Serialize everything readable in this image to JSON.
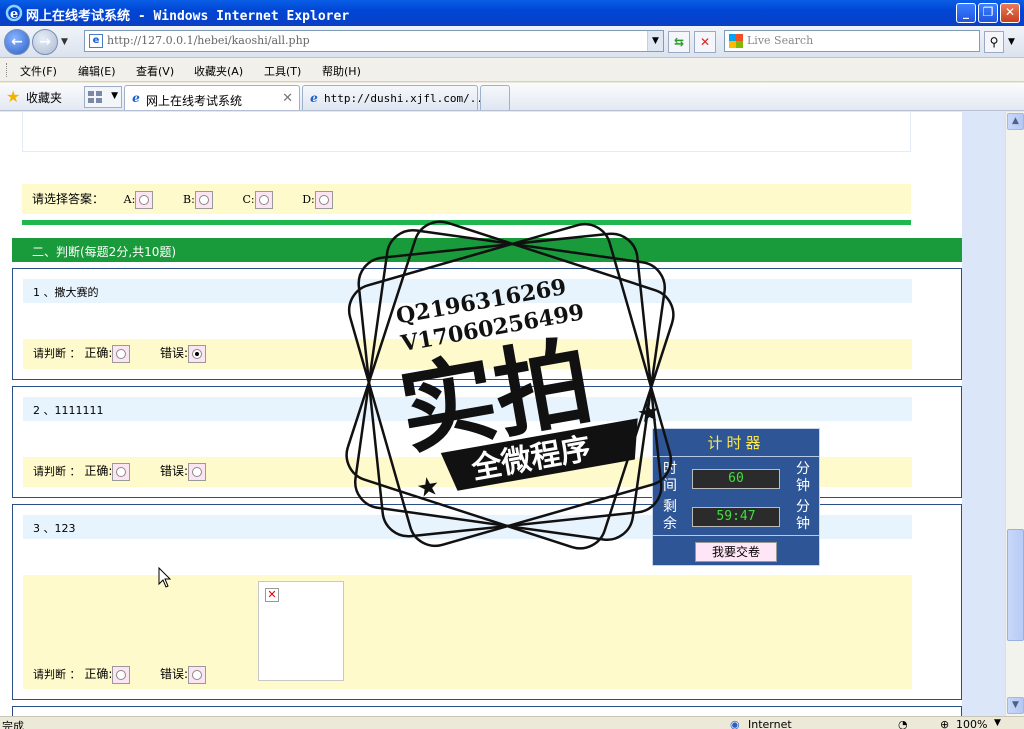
{
  "window": {
    "title": "网上在线考试系统 - Windows Internet Explorer",
    "minimize": "_",
    "restore": "❐",
    "close": "✕"
  },
  "address": {
    "url": "http://127.0.0.1/hebei/kaoshi/all.php",
    "search_placeholder": "Live Search"
  },
  "menu": [
    "文件(F)",
    "编辑(E)",
    "查看(V)",
    "收藏夹(A)",
    "工具(T)",
    "帮助(H)"
  ],
  "favorites": {
    "label": "收藏夹",
    "tabs": [
      {
        "label": "网上在线考试系统"
      },
      {
        "label": "http://dushi.xjfl.com/..."
      }
    ]
  },
  "exam": {
    "choice_prompt": "请选择答案：",
    "choice_options": [
      "A:",
      "B:",
      "C:",
      "D:"
    ],
    "section_title": "二、判断(每题2分,共10题)",
    "judge_prefix": "请判断 ：",
    "correct_label": "正确:",
    "wrong_label": "错误:",
    "questions": [
      {
        "text": "1 、撒大赛的",
        "selected": "wrong"
      },
      {
        "text": "2 、1111111",
        "selected": "none"
      },
      {
        "text": "3 、123",
        "selected": "none"
      }
    ]
  },
  "timer": {
    "title": "计时器",
    "total_label": [
      "时",
      "间"
    ],
    "remain_label": [
      "剩",
      "余"
    ],
    "unit": [
      "分",
      "钟"
    ],
    "total_value": "60",
    "remain_value": "59:47",
    "submit_label": "我要交卷"
  },
  "watermark": {
    "line1": "Q2196316269",
    "line2": "V17060256499",
    "big": "实拍",
    "banner": "全微程序"
  },
  "status": {
    "left": "完成",
    "zone": "Internet",
    "zoom": "100%"
  }
}
